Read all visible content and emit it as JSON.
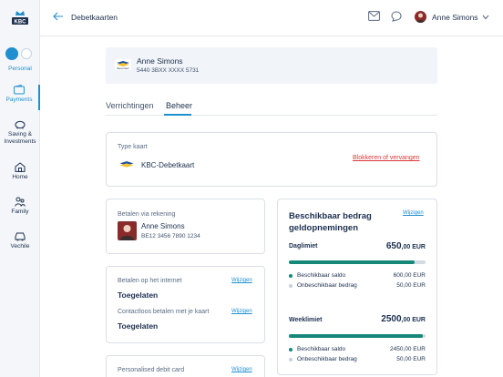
{
  "brand": {
    "logo_text": "KBC",
    "accent": "#1f8fd0",
    "teal": "#16887a",
    "red": "#d9383a"
  },
  "sidebar": {
    "items": [
      {
        "label": "Personal",
        "icon": "personal-icon"
      },
      {
        "label": "Payments",
        "icon": "wallet-icon"
      },
      {
        "label": "Saving & Investments",
        "icon": "piggy-bank-icon"
      },
      {
        "label": "Home",
        "icon": "home-icon"
      },
      {
        "label": "Family",
        "icon": "family-icon"
      },
      {
        "label": "Vechile",
        "icon": "car-icon"
      }
    ]
  },
  "header": {
    "title": "Debetkaarten",
    "user_name": "Anne Simons"
  },
  "card": {
    "holder": "Anne Simons",
    "number": "5440 3BXX XXXX 5731",
    "brand_text": "Bancontact"
  },
  "tabs": [
    {
      "label": "Verrichtingen",
      "active": false
    },
    {
      "label": "Beheer",
      "active": true
    }
  ],
  "card_type": {
    "label": "Type kaart",
    "name": "KBC-Debetkaart",
    "action": "Blokkeren of vervangen"
  },
  "account": {
    "label": "Betalen via rekening",
    "name": "Anne Simons",
    "iban": "BE12 3456 7890 1234"
  },
  "internet": {
    "label": "Betalen op het internet",
    "value": "Toegelaten",
    "action": "Wijzigen"
  },
  "contactless": {
    "label": "Contactloos betalen met je kaart",
    "value": "Toegelaten",
    "action": "Wijzigen"
  },
  "personalised": {
    "label": "Personalised debit card",
    "action": "Wijzigen"
  },
  "limits": {
    "title": "Beschikbaar bedrag geldopnemingen",
    "action": "Wijzigen",
    "daily": {
      "label": "Daglimiet",
      "amount_main": "650",
      "amount_dec": ",00 EUR",
      "available_fraction": 0.923,
      "rows": [
        {
          "label": "Beschikbaar saldo",
          "value": "600,00 EUR"
        },
        {
          "label": "Onbeschikbaar bedrag",
          "value": "50,00 EUR"
        }
      ]
    },
    "weekly": {
      "label": "Weeklimiet",
      "amount_main": "2500",
      "amount_dec": ",00 EUR",
      "available_fraction": 0.98,
      "rows": [
        {
          "label": "Beschikbaar saldo",
          "value": "2450,00 EUR"
        },
        {
          "label": "Onbeschikbaar bedrag",
          "value": "50,00 EUR"
        }
      ]
    }
  }
}
